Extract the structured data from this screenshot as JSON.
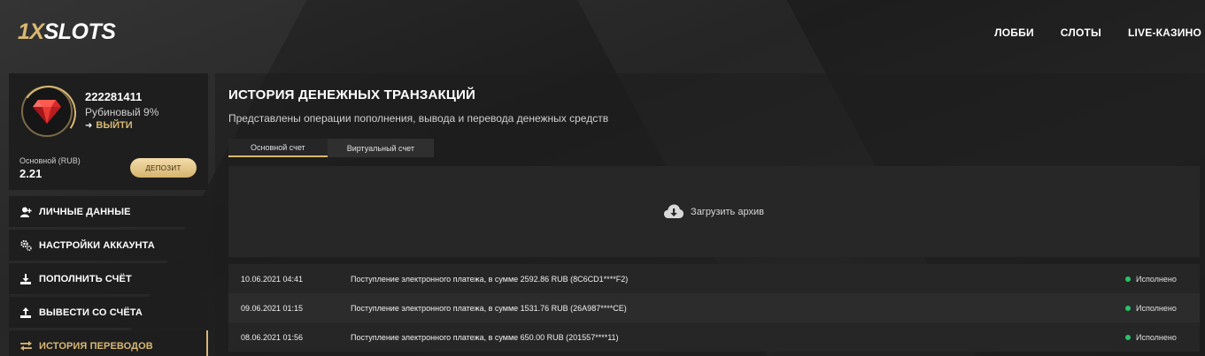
{
  "brand": {
    "logo_prefix": "1X",
    "logo_rest": "SLOTS",
    "accent": "#d9b873"
  },
  "nav": [
    {
      "label": "ЛОББИ"
    },
    {
      "label": "СЛОТЫ"
    },
    {
      "label": "LIVE-КАЗИНО"
    }
  ],
  "profile": {
    "user_id": "222281411",
    "level": "Рубиновый 9%",
    "logout_label": "ВЫЙТИ",
    "balance_label": "Основной (RUB)",
    "balance_value": "2.21",
    "deposit_label": "ДЕПОЗИТ",
    "avatar_icon": "ruby-gem-icon"
  },
  "menu": [
    {
      "label": "ЛИЧНЫЕ ДАННЫЕ",
      "icon": "user-plus-icon"
    },
    {
      "label": "НАСТРОЙКИ АККАУНТА",
      "icon": "gears-icon"
    },
    {
      "label": "ПОПОЛНИТЬ СЧЁТ",
      "icon": "download-tray-icon"
    },
    {
      "label": "ВЫВЕСТИ СО СЧЁТА",
      "icon": "upload-tray-icon"
    },
    {
      "label": "ИСТОРИЯ ПЕРЕВОДОВ",
      "icon": "transfer-arrows-icon",
      "active": true
    }
  ],
  "main": {
    "title": "ИСТОРИЯ ДЕНЕЖНЫХ ТРАНЗАКЦИЙ",
    "subtitle": "Представлены операции пополнения, вывода и перевода денежных средств",
    "tabs": [
      {
        "label": "Основной счет",
        "active": true
      },
      {
        "label": "Виртуальный счет",
        "active": false
      }
    ],
    "archive_label": "Загрузить архив",
    "transactions": [
      {
        "date": "10.06.2021 04:41",
        "description": "Поступление электронного платежа, в сумме 2592.86 RUB (8C6CD1****F2)",
        "status": "Исполнено"
      },
      {
        "date": "09.06.2021 01:15",
        "description": "Поступление электронного платежа, в сумме 1531.76 RUB (26A987****CE)",
        "status": "Исполнено"
      },
      {
        "date": "08.06.2021 01:56",
        "description": "Поступление электронного платежа, в сумме 650.00 RUB (201557****11)",
        "status": "Исполнено"
      }
    ],
    "status_color": "#27c46a"
  }
}
